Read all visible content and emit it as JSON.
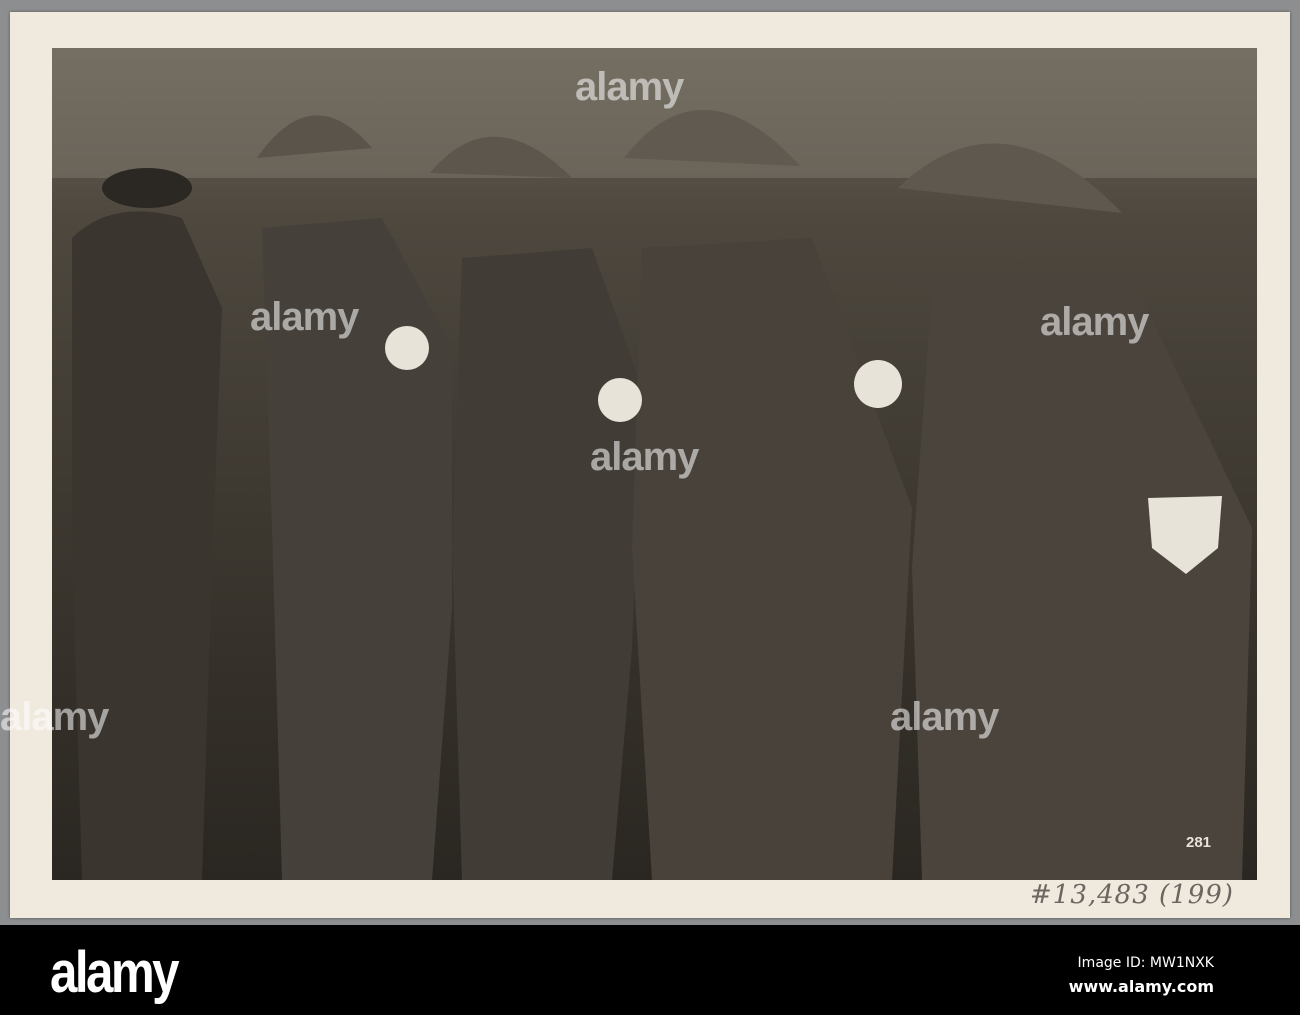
{
  "photo": {
    "print_number": "281",
    "handwritten_note": "#13,483 (199)"
  },
  "watermark": {
    "text": "alamy"
  },
  "footer": {
    "logo": "alamy",
    "image_id": "Image ID: MW1NXK",
    "url": "www.alamy.com"
  }
}
